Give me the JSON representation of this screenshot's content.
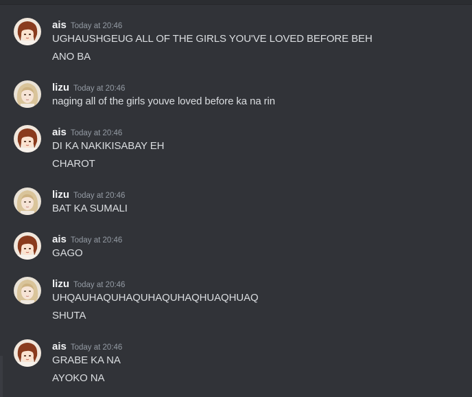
{
  "messages": [
    {
      "author": "ais",
      "timestamp": "Today at 20:46",
      "lines": [
        "UGHAUSHGEUG ALL OF THE GIRLS YOU'VE LOVED BEFORE BEH",
        "ANO BA"
      ]
    },
    {
      "author": "lizu",
      "timestamp": "Today at 20:46",
      "lines": [
        "naging all of the girls youve loved before ka na rin"
      ]
    },
    {
      "author": "ais",
      "timestamp": "Today at 20:46",
      "lines": [
        "DI KA NAKIKISABAY EH",
        "CHAROT"
      ]
    },
    {
      "author": "lizu",
      "timestamp": "Today at 20:46",
      "lines": [
        "BAT KA SUMALI"
      ]
    },
    {
      "author": "ais",
      "timestamp": "Today at 20:46",
      "lines": [
        "GAGO"
      ]
    },
    {
      "author": "lizu",
      "timestamp": "Today at 20:46",
      "lines": [
        "UHQAUHAQUHAQUHAQUHAQHUAQHUAQ",
        "SHUTA"
      ]
    },
    {
      "author": "ais",
      "timestamp": "Today at 20:46",
      "lines": [
        "GRABE KA NA",
        "AYOKO NA"
      ]
    }
  ],
  "colors": {
    "background": "#313338",
    "username": "#f2f3f5",
    "timestamp": "#949ba4",
    "message_text": "#dbdee1"
  },
  "icons": {
    "ais_avatar": "anime-girl-brown-hair-avatar",
    "lizu_avatar": "blonde-girl-photo-avatar"
  }
}
